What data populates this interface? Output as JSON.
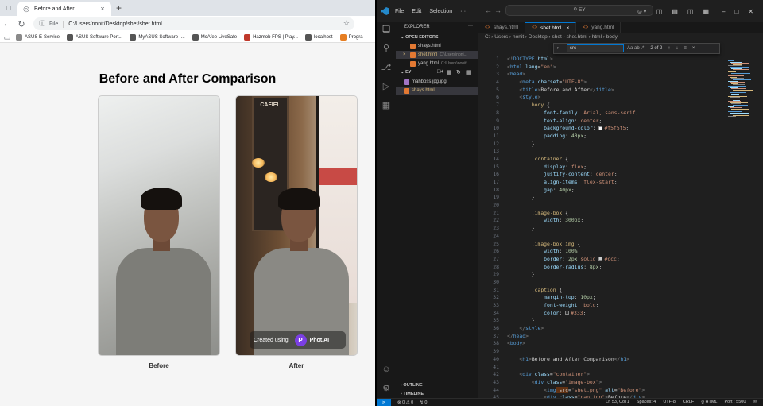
{
  "browser": {
    "tab_title": "Before and After",
    "new_tab": "+",
    "address_label": "File",
    "url": "C:/Users/nonit/Desktop/shet/shet.html",
    "bookmarks": [
      {
        "label": "ASUS E-Service",
        "color": "#8a8a8a"
      },
      {
        "label": "ASUS Software Port...",
        "color": "#555555"
      },
      {
        "label": "MyASUS Software -...",
        "color": "#555555"
      },
      {
        "label": "McAfee LiveSafe",
        "color": "#555555"
      },
      {
        "label": "Hazmob FPS | Play...",
        "color": "#c0392b"
      },
      {
        "label": "localhost",
        "color": "#555555"
      },
      {
        "label": "Progra",
        "color": "#e67e22"
      }
    ]
  },
  "page": {
    "title": "Before and After Comparison",
    "before_caption": "Before",
    "after_caption": "After",
    "badge_text": "Created using",
    "badge_logo": "P",
    "badge_brand": "Phot.AI",
    "board_text": "CAFIEL"
  },
  "vscode": {
    "menu": [
      "File",
      "Edit",
      "Selection",
      "···"
    ],
    "command_center": "EY",
    "explorer_title": "EXPLORER",
    "open_editors_title": "OPEN EDITORS",
    "open_editors": [
      {
        "name": "shays.html",
        "path": ""
      },
      {
        "name": "shet.html",
        "path": "C:\\Users\\noni..."
      },
      {
        "name": "yang.html",
        "path": "C:\\Users\\nonit\\..."
      }
    ],
    "folder_title": "EY",
    "folder_files": [
      {
        "name": "mahboss.jpg.jpg"
      },
      {
        "name": "shays.html"
      }
    ],
    "outline_title": "OUTLINE",
    "timeline_title": "TIMELINE",
    "tabs": [
      {
        "name": "shays.html",
        "active": false
      },
      {
        "name": "shet.html",
        "active": true
      },
      {
        "name": "yang.html",
        "active": false
      }
    ],
    "breadcrumb": "C: › Users › nonit › Desktop › shet › shet.html › html › body",
    "find": {
      "query": "src",
      "options": "Aa  ab  .*",
      "count": "2 of 2"
    },
    "status": {
      "errors": "⊗ 0 ⚠ 0",
      "right": [
        "Ln 53, Col 1",
        "Spaces: 4",
        "UTF-8",
        "CRLF",
        "{} HTML",
        "Port : 5500"
      ]
    },
    "code_lines": [
      [
        [
          "tk",
          "<!"
        ],
        [
          "tg",
          "DOCTYPE"
        ],
        [
          "at",
          " html"
        ],
        [
          "tk",
          ">"
        ]
      ],
      [
        [
          "tk",
          "<"
        ],
        [
          "tg",
          "html"
        ],
        [
          "at",
          " lang"
        ],
        [
          "tx",
          "="
        ],
        [
          "sv",
          "\"en\""
        ],
        [
          "tk",
          ">"
        ]
      ],
      [
        [
          "tk",
          "<"
        ],
        [
          "tg",
          "head"
        ],
        [
          "tk",
          ">"
        ]
      ],
      [
        [
          "tx",
          "    "
        ],
        [
          "tk",
          "<"
        ],
        [
          "tg",
          "meta"
        ],
        [
          "at",
          " charset"
        ],
        [
          "tx",
          "="
        ],
        [
          "sv",
          "\"UTF-8\""
        ],
        [
          "tk",
          ">"
        ]
      ],
      [
        [
          "tx",
          "    "
        ],
        [
          "tk",
          "<"
        ],
        [
          "tg",
          "title"
        ],
        [
          "tk",
          ">"
        ],
        [
          "tx",
          "Before and After"
        ],
        [
          "tk",
          "</"
        ],
        [
          "tg",
          "title"
        ],
        [
          "tk",
          ">"
        ]
      ],
      [
        [
          "tx",
          "    "
        ],
        [
          "tk",
          "<"
        ],
        [
          "tg",
          "style"
        ],
        [
          "tk",
          ">"
        ]
      ],
      [
        [
          "tx",
          "        "
        ],
        [
          "sel",
          "body"
        ],
        [
          "tx",
          " {"
        ]
      ],
      [
        [
          "tx",
          "            "
        ],
        [
          "pr",
          "font-family"
        ],
        [
          "tx",
          ": "
        ],
        [
          "vl",
          "Arial, sans-serif"
        ],
        [
          "tx",
          ";"
        ]
      ],
      [
        [
          "tx",
          "            "
        ],
        [
          "pr",
          "text-align"
        ],
        [
          "tx",
          ": "
        ],
        [
          "vl",
          "center"
        ],
        [
          "tx",
          ";"
        ]
      ],
      [
        [
          "tx",
          "            "
        ],
        [
          "pr",
          "background-color"
        ],
        [
          "tx",
          ": "
        ],
        [
          "sw",
          "#f5f5f5"
        ],
        [
          "vl",
          "#f5f5f5"
        ],
        [
          "tx",
          ";"
        ]
      ],
      [
        [
          "tx",
          "            "
        ],
        [
          "pr",
          "padding"
        ],
        [
          "tx",
          ": "
        ],
        [
          "nm",
          "40px"
        ],
        [
          "tx",
          ";"
        ]
      ],
      [
        [
          "tx",
          "        }"
        ]
      ],
      [
        [
          "tx",
          ""
        ]
      ],
      [
        [
          "tx",
          "        "
        ],
        [
          "sel",
          ".container"
        ],
        [
          "tx",
          " {"
        ]
      ],
      [
        [
          "tx",
          "            "
        ],
        [
          "pr",
          "display"
        ],
        [
          "tx",
          ": "
        ],
        [
          "vl",
          "flex"
        ],
        [
          "tx",
          ";"
        ]
      ],
      [
        [
          "tx",
          "            "
        ],
        [
          "pr",
          "justify-content"
        ],
        [
          "tx",
          ": "
        ],
        [
          "vl",
          "center"
        ],
        [
          "tx",
          ";"
        ]
      ],
      [
        [
          "tx",
          "            "
        ],
        [
          "pr",
          "align-items"
        ],
        [
          "tx",
          ": "
        ],
        [
          "vl",
          "flex-start"
        ],
        [
          "tx",
          ";"
        ]
      ],
      [
        [
          "tx",
          "            "
        ],
        [
          "pr",
          "gap"
        ],
        [
          "tx",
          ": "
        ],
        [
          "nm",
          "40px"
        ],
        [
          "tx",
          ";"
        ]
      ],
      [
        [
          "tx",
          "        }"
        ]
      ],
      [
        [
          "tx",
          ""
        ]
      ],
      [
        [
          "tx",
          "        "
        ],
        [
          "sel",
          ".image-box"
        ],
        [
          "tx",
          " {"
        ]
      ],
      [
        [
          "tx",
          "            "
        ],
        [
          "pr",
          "width"
        ],
        [
          "tx",
          ": "
        ],
        [
          "nm",
          "300px"
        ],
        [
          "tx",
          ";"
        ]
      ],
      [
        [
          "tx",
          "        }"
        ]
      ],
      [
        [
          "tx",
          ""
        ]
      ],
      [
        [
          "tx",
          "        "
        ],
        [
          "sel",
          ".image-box img"
        ],
        [
          "tx",
          " {"
        ]
      ],
      [
        [
          "tx",
          "            "
        ],
        [
          "pr",
          "width"
        ],
        [
          "tx",
          ": "
        ],
        [
          "nm",
          "100%"
        ],
        [
          "tx",
          ";"
        ]
      ],
      [
        [
          "tx",
          "            "
        ],
        [
          "pr",
          "border"
        ],
        [
          "tx",
          ": "
        ],
        [
          "nm",
          "2px"
        ],
        [
          "vl",
          " solid "
        ],
        [
          "sw",
          "#cccccc"
        ],
        [
          "vl",
          "#ccc"
        ],
        [
          "tx",
          ";"
        ]
      ],
      [
        [
          "tx",
          "            "
        ],
        [
          "pr",
          "border-radius"
        ],
        [
          "tx",
          ": "
        ],
        [
          "nm",
          "8px"
        ],
        [
          "tx",
          ";"
        ]
      ],
      [
        [
          "tx",
          "        }"
        ]
      ],
      [
        [
          "tx",
          ""
        ]
      ],
      [
        [
          "tx",
          "        "
        ],
        [
          "sel",
          ".caption"
        ],
        [
          "tx",
          " {"
        ]
      ],
      [
        [
          "tx",
          "            "
        ],
        [
          "pr",
          "margin-top"
        ],
        [
          "tx",
          ": "
        ],
        [
          "nm",
          "10px"
        ],
        [
          "tx",
          ";"
        ]
      ],
      [
        [
          "tx",
          "            "
        ],
        [
          "pr",
          "font-weight"
        ],
        [
          "tx",
          ": "
        ],
        [
          "vl",
          "bold"
        ],
        [
          "tx",
          ";"
        ]
      ],
      [
        [
          "tx",
          "            "
        ],
        [
          "pr",
          "color"
        ],
        [
          "tx",
          ": "
        ],
        [
          "sw",
          "#333333"
        ],
        [
          "vl",
          "#333"
        ],
        [
          "tx",
          ";"
        ]
      ],
      [
        [
          "tx",
          "        }"
        ]
      ],
      [
        [
          "tx",
          "    "
        ],
        [
          "tk",
          "</"
        ],
        [
          "tg",
          "style"
        ],
        [
          "tk",
          ">"
        ]
      ],
      [
        [
          "tk",
          "</"
        ],
        [
          "tg",
          "head"
        ],
        [
          "tk",
          ">"
        ]
      ],
      [
        [
          "tk",
          "<"
        ],
        [
          "tg",
          "body"
        ],
        [
          "tk",
          ">"
        ]
      ],
      [
        [
          "tx",
          ""
        ]
      ],
      [
        [
          "tx",
          "    "
        ],
        [
          "tk",
          "<"
        ],
        [
          "tg",
          "h1"
        ],
        [
          "tk",
          ">"
        ],
        [
          "tx",
          "Before and After Comparison"
        ],
        [
          "tk",
          "</"
        ],
        [
          "tg",
          "h1"
        ],
        [
          "tk",
          ">"
        ]
      ],
      [
        [
          "tx",
          ""
        ]
      ],
      [
        [
          "tx",
          "    "
        ],
        [
          "tk",
          "<"
        ],
        [
          "tg",
          "div"
        ],
        [
          "at",
          " class"
        ],
        [
          "tx",
          "="
        ],
        [
          "sv",
          "\"container\""
        ],
        [
          "tk",
          ">"
        ]
      ],
      [
        [
          "tx",
          "        "
        ],
        [
          "tk",
          "<"
        ],
        [
          "tg",
          "div"
        ],
        [
          "at",
          " class"
        ],
        [
          "tx",
          "="
        ],
        [
          "sv",
          "\"image-box\""
        ],
        [
          "tk",
          ">"
        ]
      ],
      [
        [
          "tx",
          "            "
        ],
        [
          "tk",
          "<"
        ],
        [
          "tg",
          "img"
        ],
        [
          "hl",
          " src"
        ],
        [
          "tx",
          "="
        ],
        [
          "sv",
          "\"shet.png\""
        ],
        [
          "at",
          " alt"
        ],
        [
          "tx",
          "="
        ],
        [
          "sv",
          "\"Before\""
        ],
        [
          "tk",
          ">"
        ]
      ],
      [
        [
          "tx",
          "            "
        ],
        [
          "tk",
          "<"
        ],
        [
          "tg",
          "div"
        ],
        [
          "at",
          " class"
        ],
        [
          "tx",
          "="
        ],
        [
          "sv",
          "\"caption\""
        ],
        [
          "tk",
          ">"
        ],
        [
          "tx",
          "Before"
        ],
        [
          "tk",
          "</"
        ],
        [
          "tg",
          "div"
        ],
        [
          "tk",
          ">"
        ]
      ]
    ]
  }
}
